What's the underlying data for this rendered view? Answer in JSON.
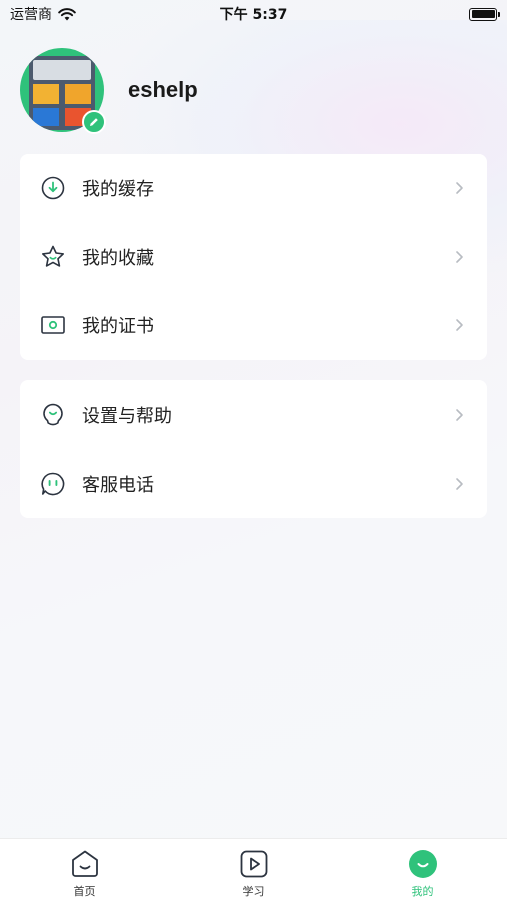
{
  "status_bar": {
    "carrier": "运营商",
    "time": "下午 5:37"
  },
  "profile": {
    "username": "eshelp"
  },
  "menu_group_1": [
    {
      "label": "我的缓存",
      "icon": "download-circle-icon"
    },
    {
      "label": "我的收藏",
      "icon": "star-icon"
    },
    {
      "label": "我的证书",
      "icon": "certificate-icon"
    }
  ],
  "menu_group_2": [
    {
      "label": "设置与帮助",
      "icon": "lightbulb-icon"
    },
    {
      "label": "客服电话",
      "icon": "chat-bubble-icon"
    }
  ],
  "tabbar": {
    "tabs": [
      {
        "label": "首页",
        "icon": "home-icon",
        "active": false
      },
      {
        "label": "学习",
        "icon": "play-icon",
        "active": false
      },
      {
        "label": "我的",
        "icon": "profile-smile-icon",
        "active": true
      }
    ]
  },
  "colors": {
    "accent": "#2fc27b",
    "icon_stroke": "#2c3440"
  }
}
